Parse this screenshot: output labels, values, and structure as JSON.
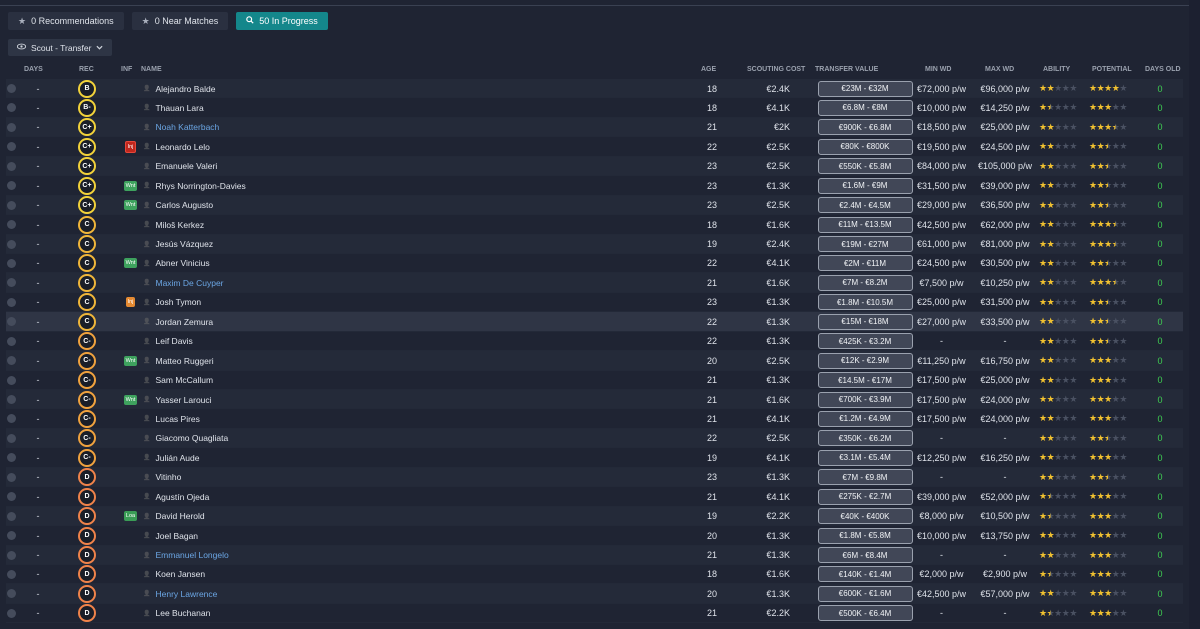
{
  "filters": [
    {
      "label": "0 Recommendations",
      "icon": "star-icon",
      "active": false
    },
    {
      "label": "0 Near Matches",
      "icon": "star-icon",
      "active": false
    },
    {
      "label": "50 In Progress",
      "icon": "search-icon",
      "active": true
    }
  ],
  "scout_dropdown": {
    "label": "Scout - Transfer",
    "icon": "eye-icon"
  },
  "columns": {
    "days": "DAYS",
    "rec": "REC",
    "inf": "INF",
    "name": "NAME",
    "age": "AGE",
    "scouting_cost": "SCOUTING COST",
    "transfer_value": "TRANSFER VALUE",
    "min_wd": "MIN WD",
    "max_wd": "MAX WD",
    "ability": "ABILITY",
    "potential": "POTENTIAL",
    "days_old": "DAYS OLD"
  },
  "rows": [
    {
      "days": "-",
      "rec": "B",
      "inf": "",
      "name": "Alejandro Balde",
      "link": false,
      "age": "18",
      "cost": "€2.4K",
      "tv": "€23M - €32M",
      "minwd": "€72,000 p/w",
      "maxwd": "€96,000 p/w",
      "ability": 2,
      "potential": 4,
      "days_old": "0"
    },
    {
      "days": "-",
      "rec": "B-",
      "inf": "",
      "name": "Thauan Lara",
      "link": false,
      "age": "18",
      "cost": "€4.1K",
      "tv": "€6.8M - €8M",
      "minwd": "€10,000 p/w",
      "maxwd": "€14,250 p/w",
      "ability": 1.5,
      "potential": 3,
      "days_old": "0"
    },
    {
      "days": "-",
      "rec": "C+",
      "inf": "",
      "name": "Noah Katterbach",
      "link": true,
      "age": "21",
      "cost": "€2K",
      "tv": "€900K - €6.8M",
      "minwd": "€18,500 p/w",
      "maxwd": "€25,000 p/w",
      "ability": 2,
      "potential": 3.5,
      "days_old": "0"
    },
    {
      "days": "-",
      "rec": "C+",
      "inf": "Inj",
      "name": "Leonardo Lelo",
      "link": false,
      "age": "22",
      "cost": "€2.5K",
      "tv": "€80K - €800K",
      "minwd": "€19,500 p/w",
      "maxwd": "€24,500 p/w",
      "ability": 2,
      "potential": 2.5,
      "days_old": "0"
    },
    {
      "days": "-",
      "rec": "C+",
      "inf": "",
      "name": "Emanuele Valeri",
      "link": false,
      "age": "23",
      "cost": "€2.5K",
      "tv": "€550K - €5.8M",
      "minwd": "€84,000 p/w",
      "maxwd": "€105,000 p/w",
      "ability": 2,
      "potential": 2.5,
      "days_old": "0"
    },
    {
      "days": "-",
      "rec": "C+",
      "inf": "Wnt",
      "name": "Rhys Norrington-Davies",
      "link": false,
      "age": "23",
      "cost": "€1.3K",
      "tv": "€1.6M - €9M",
      "minwd": "€31,500 p/w",
      "maxwd": "€39,000 p/w",
      "ability": 2,
      "potential": 2.5,
      "days_old": "0"
    },
    {
      "days": "-",
      "rec": "C+",
      "inf": "Wnt",
      "name": "Carlos Augusto",
      "link": false,
      "age": "23",
      "cost": "€2.5K",
      "tv": "€2.4M - €4.5M",
      "minwd": "€29,000 p/w",
      "maxwd": "€36,500 p/w",
      "ability": 2,
      "potential": 2.5,
      "days_old": "0"
    },
    {
      "days": "-",
      "rec": "C",
      "inf": "",
      "name": "Miloš Kerkez",
      "link": false,
      "age": "18",
      "cost": "€1.6K",
      "tv": "€11M - €13.5M",
      "minwd": "€42,500 p/w",
      "maxwd": "€62,000 p/w",
      "ability": 2,
      "potential": 3.5,
      "days_old": "0"
    },
    {
      "days": "-",
      "rec": "C",
      "inf": "",
      "name": "Jesús Vázquez",
      "link": false,
      "age": "19",
      "cost": "€2.4K",
      "tv": "€19M - €27M",
      "minwd": "€61,000 p/w",
      "maxwd": "€81,000 p/w",
      "ability": 2,
      "potential": 3.5,
      "days_old": "0"
    },
    {
      "days": "-",
      "rec": "C",
      "inf": "Wnt",
      "name": "Abner Vinicius",
      "link": false,
      "age": "22",
      "cost": "€4.1K",
      "tv": "€2M - €11M",
      "minwd": "€24,500 p/w",
      "maxwd": "€30,500 p/w",
      "ability": 2,
      "potential": 2.5,
      "days_old": "0"
    },
    {
      "days": "-",
      "rec": "C",
      "inf": "",
      "name": "Maxim De Cuyper",
      "link": true,
      "age": "21",
      "cost": "€1.6K",
      "tv": "€7M - €8.2M",
      "minwd": "€7,500 p/w",
      "maxwd": "€10,250 p/w",
      "ability": 2,
      "potential": 3.5,
      "days_old": "0"
    },
    {
      "days": "-",
      "rec": "C",
      "inf": "Inj",
      "name": "Josh Tymon",
      "link": false,
      "age": "23",
      "cost": "€1.3K",
      "tv": "€1.8M - €10.5M",
      "minwd": "€25,000 p/w",
      "maxwd": "€31,500 p/w",
      "ability": 2,
      "potential": 2.5,
      "days_old": "0"
    },
    {
      "days": "-",
      "rec": "C",
      "inf": "",
      "name": "Jordan Zemura",
      "link": false,
      "age": "22",
      "cost": "€1.3K",
      "tv": "€15M - €18M",
      "minwd": "€27,000 p/w",
      "maxwd": "€33,500 p/w",
      "ability": 2,
      "potential": 2.5,
      "days_old": "0"
    },
    {
      "days": "-",
      "rec": "C-",
      "inf": "",
      "name": "Leif Davis",
      "link": false,
      "age": "22",
      "cost": "€1.3K",
      "tv": "€425K - €3.2M",
      "minwd": "-",
      "maxwd": "-",
      "ability": 2,
      "potential": 2.5,
      "days_old": "0"
    },
    {
      "days": "-",
      "rec": "C-",
      "inf": "Wnt",
      "name": "Matteo Ruggeri",
      "link": false,
      "age": "20",
      "cost": "€2.5K",
      "tv": "€12K - €2.9M",
      "minwd": "€11,250 p/w",
      "maxwd": "€16,750 p/w",
      "ability": 2,
      "potential": 3,
      "days_old": "0"
    },
    {
      "days": "-",
      "rec": "C-",
      "inf": "",
      "name": "Sam McCallum",
      "link": false,
      "age": "21",
      "cost": "€1.3K",
      "tv": "€14.5M - €17M",
      "minwd": "€17,500 p/w",
      "maxwd": "€25,000 p/w",
      "ability": 2,
      "potential": 3,
      "days_old": "0"
    },
    {
      "days": "-",
      "rec": "C-",
      "inf": "Wnt",
      "name": "Yasser Larouci",
      "link": false,
      "age": "21",
      "cost": "€1.6K",
      "tv": "€700K - €3.9M",
      "minwd": "€17,500 p/w",
      "maxwd": "€24,000 p/w",
      "ability": 2,
      "potential": 3,
      "days_old": "0"
    },
    {
      "days": "-",
      "rec": "C-",
      "inf": "",
      "name": "Lucas Pires",
      "link": false,
      "age": "21",
      "cost": "€4.1K",
      "tv": "€1.2M - €4.9M",
      "minwd": "€17,500 p/w",
      "maxwd": "€24,000 p/w",
      "ability": 2,
      "potential": 3,
      "days_old": "0"
    },
    {
      "days": "-",
      "rec": "C-",
      "inf": "",
      "name": "Giacomo Quagliata",
      "link": false,
      "age": "22",
      "cost": "€2.5K",
      "tv": "€350K - €6.2M",
      "minwd": "-",
      "maxwd": "-",
      "ability": 2,
      "potential": 2.5,
      "days_old": "0"
    },
    {
      "days": "-",
      "rec": "C-",
      "inf": "",
      "name": "Julián Aude",
      "link": false,
      "age": "19",
      "cost": "€4.1K",
      "tv": "€3.1M - €5.4M",
      "minwd": "€12,250 p/w",
      "maxwd": "€16,250 p/w",
      "ability": 2,
      "potential": 3,
      "days_old": "0"
    },
    {
      "days": "-",
      "rec": "D",
      "inf": "",
      "name": "Vitinho",
      "link": false,
      "age": "23",
      "cost": "€1.3K",
      "tv": "€7M - €9.8M",
      "minwd": "-",
      "maxwd": "-",
      "ability": 2,
      "potential": 2.5,
      "days_old": "0"
    },
    {
      "days": "-",
      "rec": "D",
      "inf": "",
      "name": "Agustín Ojeda",
      "link": false,
      "age": "21",
      "cost": "€4.1K",
      "tv": "€275K - €2.7M",
      "minwd": "€39,000 p/w",
      "maxwd": "€52,000 p/w",
      "ability": 1.5,
      "potential": 3,
      "days_old": "0"
    },
    {
      "days": "-",
      "rec": "D",
      "inf": "Loa",
      "name": "David Herold",
      "link": false,
      "age": "19",
      "cost": "€2.2K",
      "tv": "€40K - €400K",
      "minwd": "€8,000 p/w",
      "maxwd": "€10,500 p/w",
      "ability": 1.5,
      "potential": 3,
      "days_old": "0"
    },
    {
      "days": "-",
      "rec": "D",
      "inf": "",
      "name": "Joel Bagan",
      "link": false,
      "age": "20",
      "cost": "€1.3K",
      "tv": "€1.8M - €5.8M",
      "minwd": "€10,000 p/w",
      "maxwd": "€13,750 p/w",
      "ability": 2,
      "potential": 3,
      "days_old": "0"
    },
    {
      "days": "-",
      "rec": "D",
      "inf": "",
      "name": "Emmanuel Longelo",
      "link": true,
      "age": "21",
      "cost": "€1.3K",
      "tv": "€6M - €8.4M",
      "minwd": "-",
      "maxwd": "-",
      "ability": 2,
      "potential": 3,
      "days_old": "0"
    },
    {
      "days": "-",
      "rec": "D",
      "inf": "",
      "name": "Koen Jansen",
      "link": false,
      "age": "18",
      "cost": "€1.6K",
      "tv": "€140K - €1.4M",
      "minwd": "€2,000 p/w",
      "maxwd": "€2,900 p/w",
      "ability": 1.5,
      "potential": 3,
      "days_old": "0"
    },
    {
      "days": "-",
      "rec": "D",
      "inf": "",
      "name": "Henry Lawrence",
      "link": true,
      "age": "20",
      "cost": "€1.3K",
      "tv": "€600K - €1.6M",
      "minwd": "€42,500 p/w",
      "maxwd": "€57,000 p/w",
      "ability": 2,
      "potential": 3,
      "days_old": "0"
    },
    {
      "days": "-",
      "rec": "D",
      "inf": "",
      "name": "Lee Buchanan",
      "link": false,
      "age": "21",
      "cost": "€2.2K",
      "tv": "€500K - €6.4M",
      "minwd": "-",
      "maxwd": "-",
      "ability": 1.5,
      "potential": 3,
      "days_old": "0"
    }
  ],
  "highlight_row_name": "Jordan Zemura",
  "colors": {
    "accent": "#14878b",
    "rec_yellow": "#f2d23a",
    "rec_orange": "#f0834a",
    "star": "#f2c230",
    "days_old_green": "#3fcf52",
    "link_blue": "#6ba6e4"
  }
}
